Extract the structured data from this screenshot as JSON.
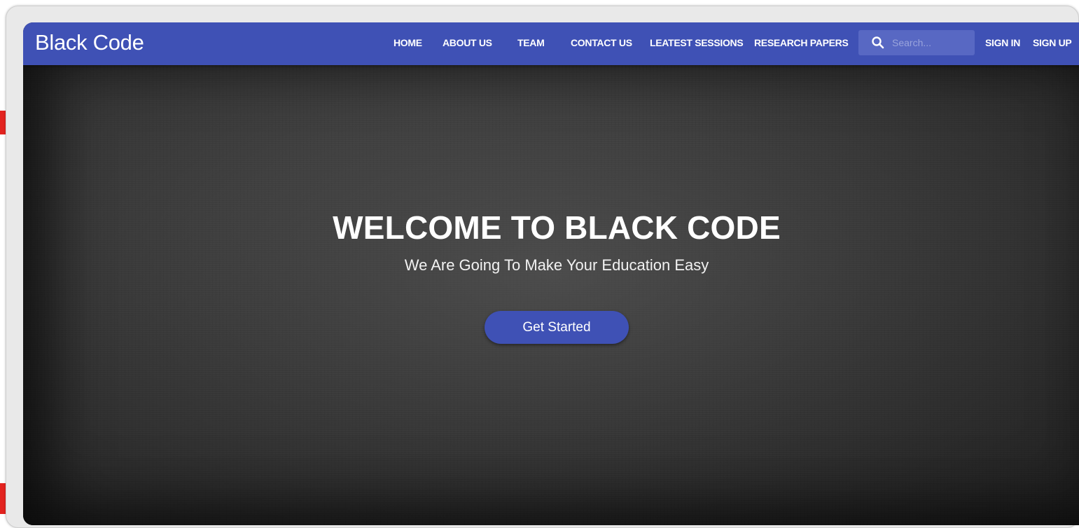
{
  "colors": {
    "primary": "#3f51b5",
    "search_bg": "#5868c3",
    "hero_bg": "#3a3a3a",
    "text": "#ffffff",
    "edge_accent": "#e3231f"
  },
  "navbar": {
    "brand": "Black Code",
    "links": [
      {
        "label": "HOME"
      },
      {
        "label": "ABOUT US"
      },
      {
        "label": "TEAM"
      },
      {
        "label": "CONTACT US"
      },
      {
        "label": "LEATEST SESSIONS"
      },
      {
        "label": "RESEARCH PAPERS"
      }
    ],
    "search": {
      "icon": "search-icon",
      "placeholder": "Search...",
      "value": ""
    },
    "auth": {
      "sign_in": "SIGN IN",
      "sign_up": "SIGN UP"
    }
  },
  "hero": {
    "title": "WELCOME TO BLACK CODE",
    "subtitle": "We Are Going To Make Your Education Easy",
    "cta_label": "Get Started"
  }
}
